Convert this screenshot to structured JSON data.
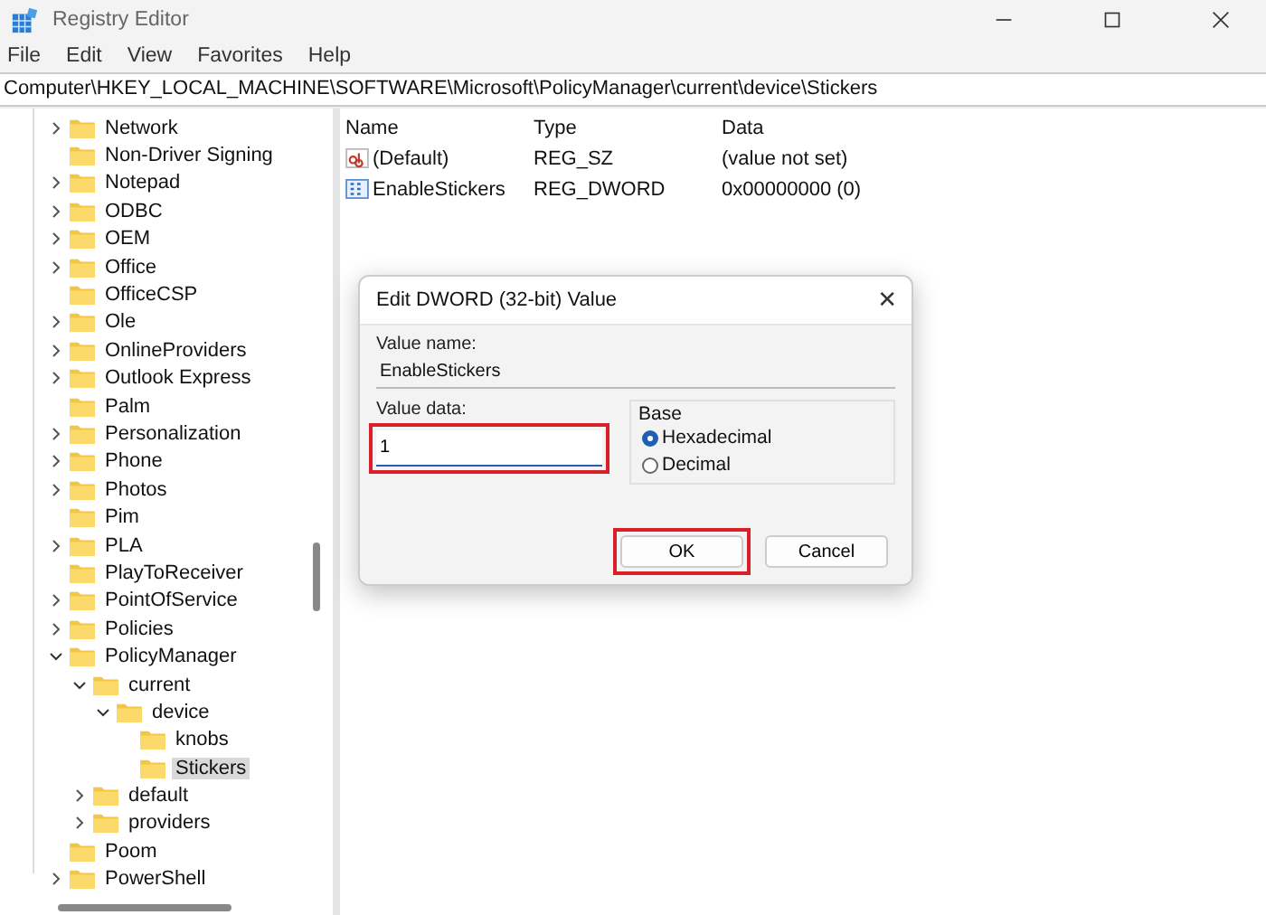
{
  "window": {
    "title": "Registry Editor"
  },
  "menu": [
    "File",
    "Edit",
    "View",
    "Favorites",
    "Help"
  ],
  "address": "Computer\\HKEY_LOCAL_MACHINE\\SOFTWARE\\Microsoft\\PolicyManager\\current\\device\\Stickers",
  "tree": [
    {
      "label": "Network",
      "kind": "collapsed",
      "selected": false
    },
    {
      "label": "Non-Driver Signing",
      "kind": "leaf",
      "selected": false
    },
    {
      "label": "Notepad",
      "kind": "collapsed",
      "selected": false
    },
    {
      "label": "ODBC",
      "kind": "collapsed",
      "selected": false
    },
    {
      "label": "OEM",
      "kind": "collapsed",
      "selected": false
    },
    {
      "label": "Office",
      "kind": "collapsed",
      "selected": false
    },
    {
      "label": "OfficeCSP",
      "kind": "leaf",
      "selected": false
    },
    {
      "label": "Ole",
      "kind": "collapsed",
      "selected": false
    },
    {
      "label": "OnlineProviders",
      "kind": "collapsed",
      "selected": false
    },
    {
      "label": "Outlook Express",
      "kind": "collapsed",
      "selected": false
    },
    {
      "label": "Palm",
      "kind": "leaf",
      "selected": false
    },
    {
      "label": "Personalization",
      "kind": "collapsed",
      "selected": false
    },
    {
      "label": "Phone",
      "kind": "collapsed",
      "selected": false
    },
    {
      "label": "Photos",
      "kind": "collapsed",
      "selected": false
    },
    {
      "label": "Pim",
      "kind": "leaf",
      "selected": false
    },
    {
      "label": "PLA",
      "kind": "collapsed",
      "selected": false
    },
    {
      "label": "PlayToReceiver",
      "kind": "leaf",
      "selected": false
    },
    {
      "label": "PointOfService",
      "kind": "collapsed",
      "selected": false
    },
    {
      "label": "Policies",
      "kind": "collapsed",
      "selected": false
    },
    {
      "label": "PolicyManager",
      "kind": "expanded",
      "selected": false,
      "children": [
        {
          "label": "current",
          "kind": "expanded",
          "selected": false,
          "children": [
            {
              "label": "device",
              "kind": "expanded",
              "selected": false,
              "children": [
                {
                  "label": "knobs",
                  "kind": "leaf",
                  "selected": false
                },
                {
                  "label": "Stickers",
                  "kind": "leaf",
                  "selected": true
                }
              ]
            }
          ]
        },
        {
          "label": "default",
          "kind": "collapsed",
          "selected": false
        },
        {
          "label": "providers",
          "kind": "collapsed",
          "selected": false
        }
      ]
    },
    {
      "label": "Poom",
      "kind": "leaf",
      "selected": false
    },
    {
      "label": "PowerShell",
      "kind": "collapsed",
      "selected": false
    }
  ],
  "values": {
    "columns": [
      "Name",
      "Type",
      "Data"
    ],
    "rows": [
      {
        "name": "(Default)",
        "kind": "string",
        "type": "REG_SZ",
        "data": "(value not set)"
      },
      {
        "name": "EnableStickers",
        "kind": "binary",
        "type": "REG_DWORD",
        "data": "0x00000000 (0)"
      }
    ]
  },
  "dialog": {
    "title": "Edit DWORD (32-bit) Value",
    "close": "✕",
    "value_name_label": "Value name:",
    "value_name": "EnableStickers",
    "value_data_label": "Value data:",
    "value_data": "1",
    "value_data_highlighted": true,
    "base_label": "Base",
    "bases": [
      {
        "label": "Hexadecimal",
        "selected": true
      },
      {
        "label": "Decimal",
        "selected": false
      }
    ],
    "buttons": [
      {
        "label": "OK",
        "highlighted": true
      },
      {
        "label": "Cancel",
        "highlighted": false
      }
    ]
  }
}
